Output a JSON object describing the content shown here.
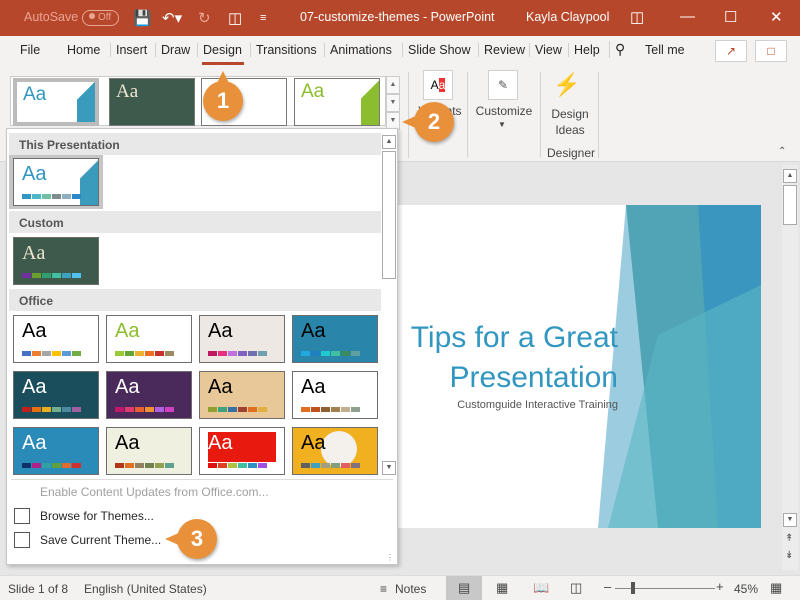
{
  "titlebar": {
    "autosave_label": "AutoSave",
    "autosave_state": "Off",
    "document_title": "07-customize-themes  -  PowerPoint",
    "user_name": "Kayla Claypool",
    "icons": [
      "save-icon",
      "undo-icon",
      "redo-icon",
      "present-icon",
      "customize-qat-icon",
      "ribbon-display-icon",
      "minimize-icon",
      "maximize-icon",
      "close-icon"
    ]
  },
  "ribbon_tabs": [
    "File",
    "Home",
    "Insert",
    "Draw",
    "Design",
    "Transitions",
    "Animations",
    "Slide Show",
    "Review",
    "View",
    "Help"
  ],
  "active_tab": "Design",
  "tell_me": "Tell me",
  "ribbon": {
    "variants_label": "Variants",
    "customize_label": "Customize",
    "design_ideas_label_1": "Design",
    "design_ideas_label_2": "Ideas",
    "designer_group": "Designer"
  },
  "themes_dropdown": {
    "sections": [
      {
        "title": "This Presentation"
      },
      {
        "title": "Custom"
      },
      {
        "title": "Office"
      }
    ],
    "menu_items": [
      {
        "label": "Enable Content Updates from Office.com...",
        "disabled": true
      },
      {
        "label": "Browse for Themes...",
        "icon": "browse-icon"
      },
      {
        "label": "Save Current Theme...",
        "icon": "save-theme-icon"
      }
    ]
  },
  "slide": {
    "title_line1": "Tips for a Great",
    "title_line2": "Presentation",
    "subtitle": "Customguide Interactive Training"
  },
  "statusbar": {
    "slide_info": "Slide 1 of 8",
    "language": "English (United States)",
    "notes": "Notes",
    "zoom": "45%"
  },
  "callouts": [
    "1",
    "2",
    "3"
  ],
  "colors": {
    "brand": "#b7472a",
    "callout": "#e8913a",
    "slide_title": "#3196c0"
  }
}
